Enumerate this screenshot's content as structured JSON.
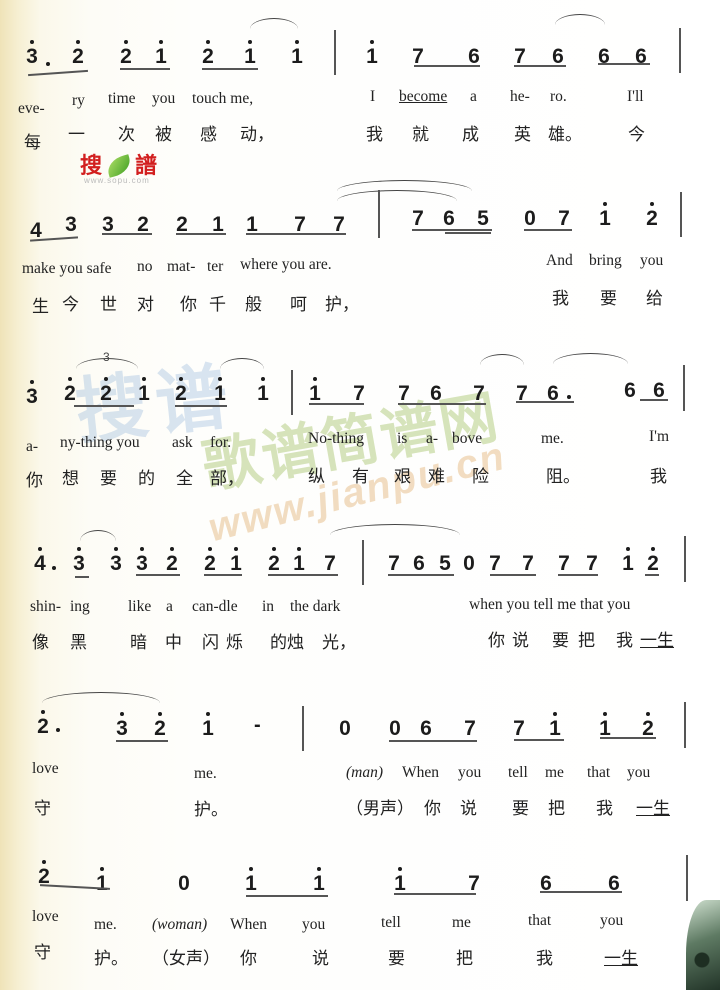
{
  "watermarks": {
    "logo_text_left": "搜",
    "logo_text_right": "譜",
    "logo_url": "www.sopu.com",
    "overlay_cn_blue": "搜谱",
    "overlay_cn_green": "歌谱简谱网",
    "overlay_url": "www.jianpu.cn"
  },
  "systems": [
    {
      "notes": [
        {
          "n": "3",
          "oct": "hi",
          "dotted": true
        },
        {
          "n": "2",
          "oct": "hi"
        },
        {
          "n": "2",
          "oct": "hi"
        },
        {
          "n": "1",
          "oct": "hi"
        },
        {
          "n": "2",
          "oct": "hi"
        },
        {
          "n": "1",
          "oct": "hi"
        },
        {
          "n": "1",
          "oct": "hi"
        },
        {
          "bar": true
        },
        {
          "n": "1",
          "oct": "hi"
        },
        {
          "n": "7"
        },
        {
          "n": "6"
        },
        {
          "n": "7"
        },
        {
          "n": "6"
        },
        {
          "n": "6"
        },
        {
          "n": "6"
        }
      ],
      "lyrics_en": [
        "eve-",
        "ry",
        "time",
        "you",
        "touch me,",
        "I",
        "become",
        "a",
        "he-",
        "ro.",
        "I'll"
      ],
      "lyrics_zh": [
        "每",
        "一",
        "次",
        "被",
        "感",
        "动，",
        "我",
        "就",
        "成",
        "英",
        "雄。",
        "今"
      ]
    },
    {
      "notes": [
        {
          "n": "4"
        },
        {
          "n": "3"
        },
        {
          "n": "3"
        },
        {
          "n": "2"
        },
        {
          "n": "2"
        },
        {
          "n": "1"
        },
        {
          "n": "1"
        },
        {
          "n": "7"
        },
        {
          "n": "7"
        },
        {
          "bar": true
        },
        {
          "n": "7"
        },
        {
          "n": "6"
        },
        {
          "n": "5"
        },
        {
          "n": "0"
        },
        {
          "n": "7"
        },
        {
          "n": "1",
          "oct": "hi"
        },
        {
          "n": "2",
          "oct": "hi"
        }
      ],
      "lyrics_en": [
        "make you safe",
        "no",
        "mat-",
        "ter",
        "where you are.",
        "And",
        "bring",
        "you"
      ],
      "lyrics_zh": [
        "生",
        "今",
        "世",
        "对",
        "你",
        "千",
        "般",
        "呵",
        "护，",
        "我",
        "要",
        "给"
      ]
    },
    {
      "triplet_label": "3",
      "notes": [
        {
          "n": "3",
          "oct": "hi"
        },
        {
          "n": "2",
          "oct": "hi"
        },
        {
          "n": "2",
          "oct": "hi"
        },
        {
          "n": "1",
          "oct": "hi"
        },
        {
          "n": "2",
          "oct": "hi"
        },
        {
          "n": "1",
          "oct": "hi"
        },
        {
          "n": "1",
          "oct": "hi"
        },
        {
          "bar": true
        },
        {
          "n": "1",
          "oct": "hi"
        },
        {
          "n": "7"
        },
        {
          "n": "7"
        },
        {
          "n": "6"
        },
        {
          "n": "7"
        },
        {
          "n": "7"
        },
        {
          "n": "6",
          "dotted": true
        },
        {
          "n": "6"
        },
        {
          "n": "6"
        }
      ],
      "lyrics_en": [
        "a-",
        "ny-thing you",
        "ask",
        "for.",
        "No-thing",
        "is",
        "a-",
        "bove",
        "me.",
        "I'm"
      ],
      "lyrics_zh": [
        "你",
        "想",
        "要",
        "的",
        "全",
        "部，",
        "纵",
        "有",
        "艰",
        "难",
        "险",
        "阻。",
        "我"
      ]
    },
    {
      "notes": [
        {
          "n": "4",
          "oct": "hi",
          "dotted": true
        },
        {
          "n": "3",
          "oct": "hi"
        },
        {
          "n": "3",
          "oct": "hi"
        },
        {
          "n": "3",
          "oct": "hi"
        },
        {
          "n": "2",
          "oct": "hi"
        },
        {
          "n": "2",
          "oct": "hi"
        },
        {
          "n": "1",
          "oct": "hi"
        },
        {
          "n": "2",
          "oct": "hi"
        },
        {
          "n": "1",
          "oct": "hi"
        },
        {
          "n": "7"
        },
        {
          "bar": true
        },
        {
          "n": "7"
        },
        {
          "n": "6"
        },
        {
          "n": "5"
        },
        {
          "n": "0"
        },
        {
          "n": "7"
        },
        {
          "n": "7"
        },
        {
          "n": "7"
        },
        {
          "n": "7"
        },
        {
          "n": "1",
          "oct": "hi"
        },
        {
          "n": "2",
          "oct": "hi"
        }
      ],
      "lyrics_en": [
        "shin-",
        "ing",
        "like",
        "a",
        "can-dle",
        "in",
        "the dark",
        "when you tell me that you"
      ],
      "lyrics_zh": [
        "像",
        "黑",
        "暗",
        "中",
        "闪",
        "烁",
        "的烛",
        "光，",
        "你",
        "说",
        "要",
        "把",
        "我",
        "一生"
      ]
    },
    {
      "notes": [
        {
          "n": "2",
          "oct": "hi",
          "dotted": true
        },
        {
          "n": "3",
          "oct": "hi"
        },
        {
          "n": "2",
          "oct": "hi"
        },
        {
          "n": "1",
          "oct": "hi"
        },
        {
          "n": "-"
        },
        {
          "bar": true
        },
        {
          "n": "0"
        },
        {
          "n": "0"
        },
        {
          "n": "6"
        },
        {
          "n": "7"
        },
        {
          "n": "7"
        },
        {
          "n": "1",
          "oct": "hi"
        },
        {
          "n": "1",
          "oct": "hi"
        },
        {
          "n": "2",
          "oct": "hi"
        }
      ],
      "lyrics_en": [
        "love",
        "me.",
        "(man)",
        "When",
        "you",
        "tell",
        "me",
        "that",
        "you"
      ],
      "lyrics_zh": [
        "守",
        "护。",
        "（男声）",
        "你",
        "说",
        "要",
        "把",
        "我",
        "一生"
      ]
    },
    {
      "notes": [
        {
          "n": "2",
          "oct": "hi"
        },
        {
          "n": "1",
          "oct": "hi"
        },
        {
          "n": "0"
        },
        {
          "n": "1",
          "oct": "hi"
        },
        {
          "n": "1",
          "oct": "hi"
        },
        {
          "n": "1",
          "oct": "hi"
        },
        {
          "n": "7"
        },
        {
          "n": "6"
        },
        {
          "n": "6"
        },
        {
          "bar": true
        }
      ],
      "lyrics_en": [
        "love",
        "me.",
        "(woman)",
        "When",
        "you",
        "tell",
        "me",
        "that",
        "you"
      ],
      "lyrics_zh": [
        "守",
        "护。",
        "（女声）",
        "你",
        "说",
        "要",
        "把",
        "我",
        "一生"
      ]
    }
  ]
}
